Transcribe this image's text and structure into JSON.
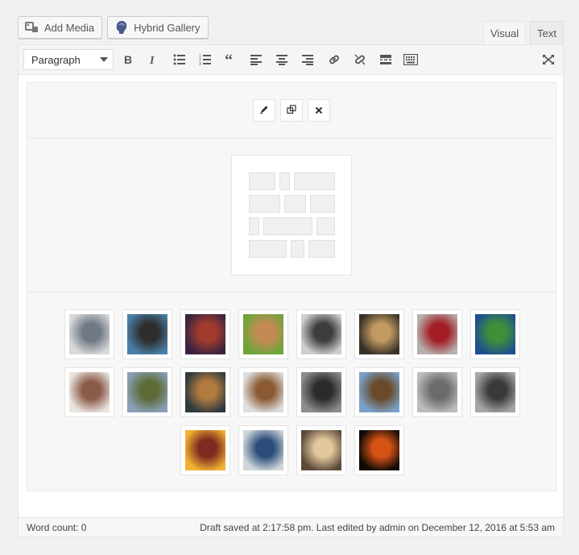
{
  "media_buttons": [
    {
      "label": "Add Media",
      "icon": "add-media-icon"
    },
    {
      "label": "Hybrid Gallery",
      "icon": "hybrid-gallery-icon"
    }
  ],
  "tabs": {
    "visual": "Visual",
    "text": "Text",
    "active": "visual"
  },
  "toolbar": {
    "format_value": "Paragraph",
    "buttons": [
      "bold-icon",
      "italic-icon",
      "bulleted-list-icon",
      "numbered-list-icon",
      "blockquote-icon",
      "align-left-icon",
      "align-center-icon",
      "align-right-icon",
      "insert-link-icon",
      "remove-link-icon",
      "read-more-icon",
      "toolbar-toggle-icon"
    ],
    "fullscreen": "fullscreen-icon"
  },
  "block_actions": [
    "edit-icon",
    "duplicate-icon",
    "delete-icon"
  ],
  "gallery": {
    "rows": [
      [
        {
          "c1": "#d9d9d9",
          "c2": "#6f7a85"
        },
        {
          "c1": "#4a7fa6",
          "c2": "#2d2d2d"
        },
        {
          "c1": "#3a2340",
          "c2": "#a23b2c"
        },
        {
          "c1": "#6da53a",
          "c2": "#c48a55"
        },
        {
          "c1": "#cfcfcf",
          "c2": "#3d3d3d"
        },
        {
          "c1": "#3a3128",
          "c2": "#c19a62"
        },
        {
          "c1": "#b6b0ad",
          "c2": "#a21d25"
        },
        {
          "c1": "#1f4f8f",
          "c2": "#3e8f3a"
        }
      ],
      [
        {
          "c1": "#e9e4de",
          "c2": "#8a5a4a"
        },
        {
          "c1": "#8aa0b8",
          "c2": "#5c6b36"
        },
        {
          "c1": "#2e3a3f",
          "c2": "#b17a3f"
        },
        {
          "c1": "#dedede",
          "c2": "#8b5a33"
        },
        {
          "c1": "#8d8d8d",
          "c2": "#2b2b2b"
        },
        {
          "c1": "#7aa2c8",
          "c2": "#6a4a2a"
        },
        {
          "c1": "#bcbcbc",
          "c2": "#6b6b6b"
        },
        {
          "c1": "#a6a6a6",
          "c2": "#3a3a3a"
        }
      ],
      [
        {
          "c1": "#f1b233",
          "c2": "#7d2b1e"
        },
        {
          "c1": "#cfd6db",
          "c2": "#2c4d7a"
        },
        {
          "c1": "#5c4a3a",
          "c2": "#e3c79d"
        },
        {
          "c1": "#110a06",
          "c2": "#d65317"
        }
      ]
    ]
  },
  "status": {
    "word_count": "Word count: 0",
    "draft_info": "Draft saved at 2:17:58 pm. Last edited by admin on December 12, 2016 at 5:53 am"
  }
}
